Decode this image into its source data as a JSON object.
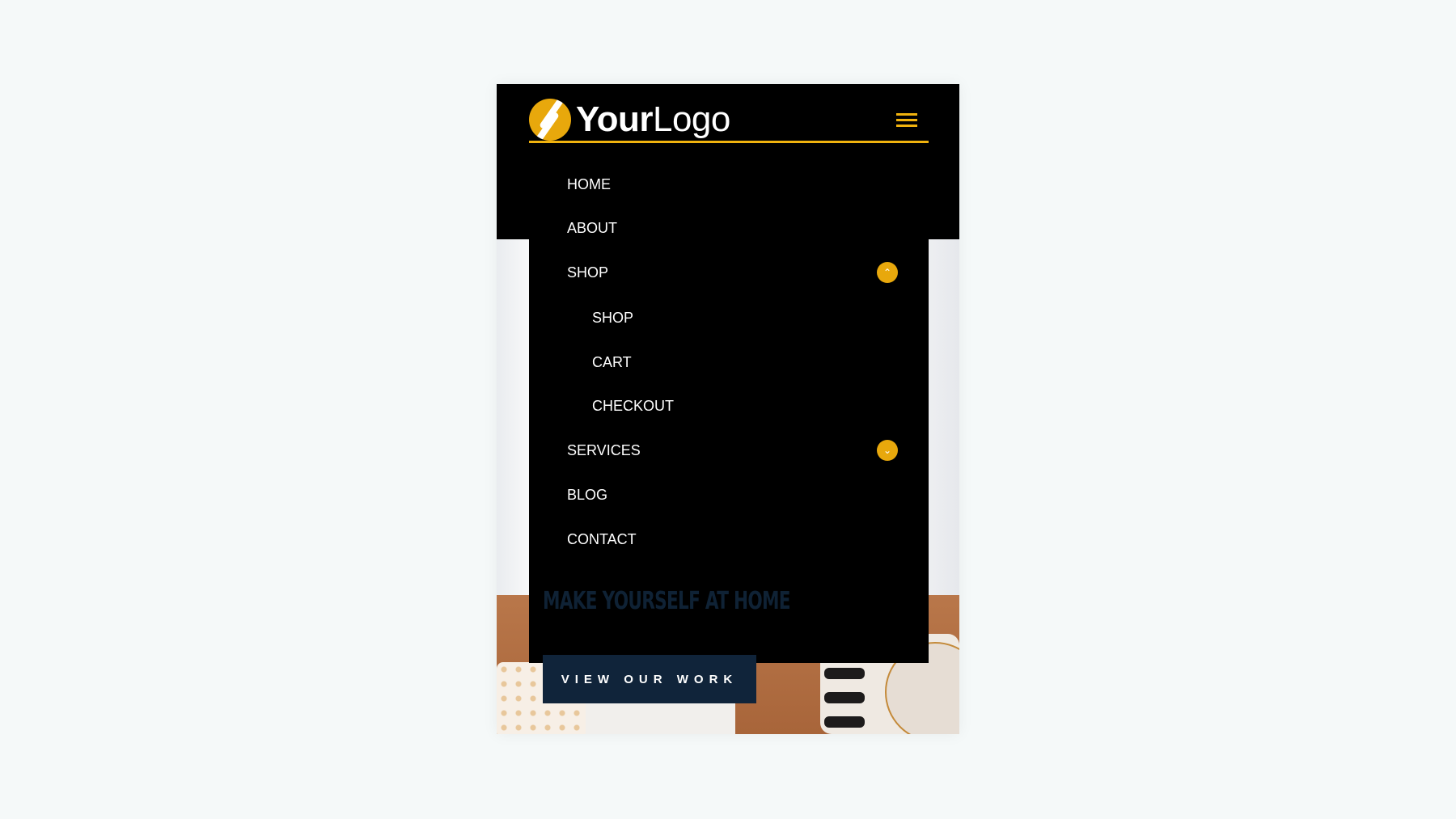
{
  "logo": {
    "text_bold": "Your",
    "text_light": "Logo",
    "accent": "#f0b20e"
  },
  "menu": {
    "items": [
      {
        "label": "HOME"
      },
      {
        "label": "ABOUT"
      },
      {
        "label": "SHOP",
        "toggle": "chevron-up-icon"
      },
      {
        "label": "SHOP",
        "sub": true
      },
      {
        "label": "CART",
        "sub": true
      },
      {
        "label": "CHECKOUT",
        "sub": true
      },
      {
        "label": "SERVICES",
        "toggle": "chevron-down-icon"
      },
      {
        "label": "BLOG"
      },
      {
        "label": "CONTACT"
      }
    ]
  },
  "hero": {
    "headline": "MAKE YOURSELF AT HOME",
    "button": "VIEW OUR WORK",
    "button_color": "#10243a"
  }
}
